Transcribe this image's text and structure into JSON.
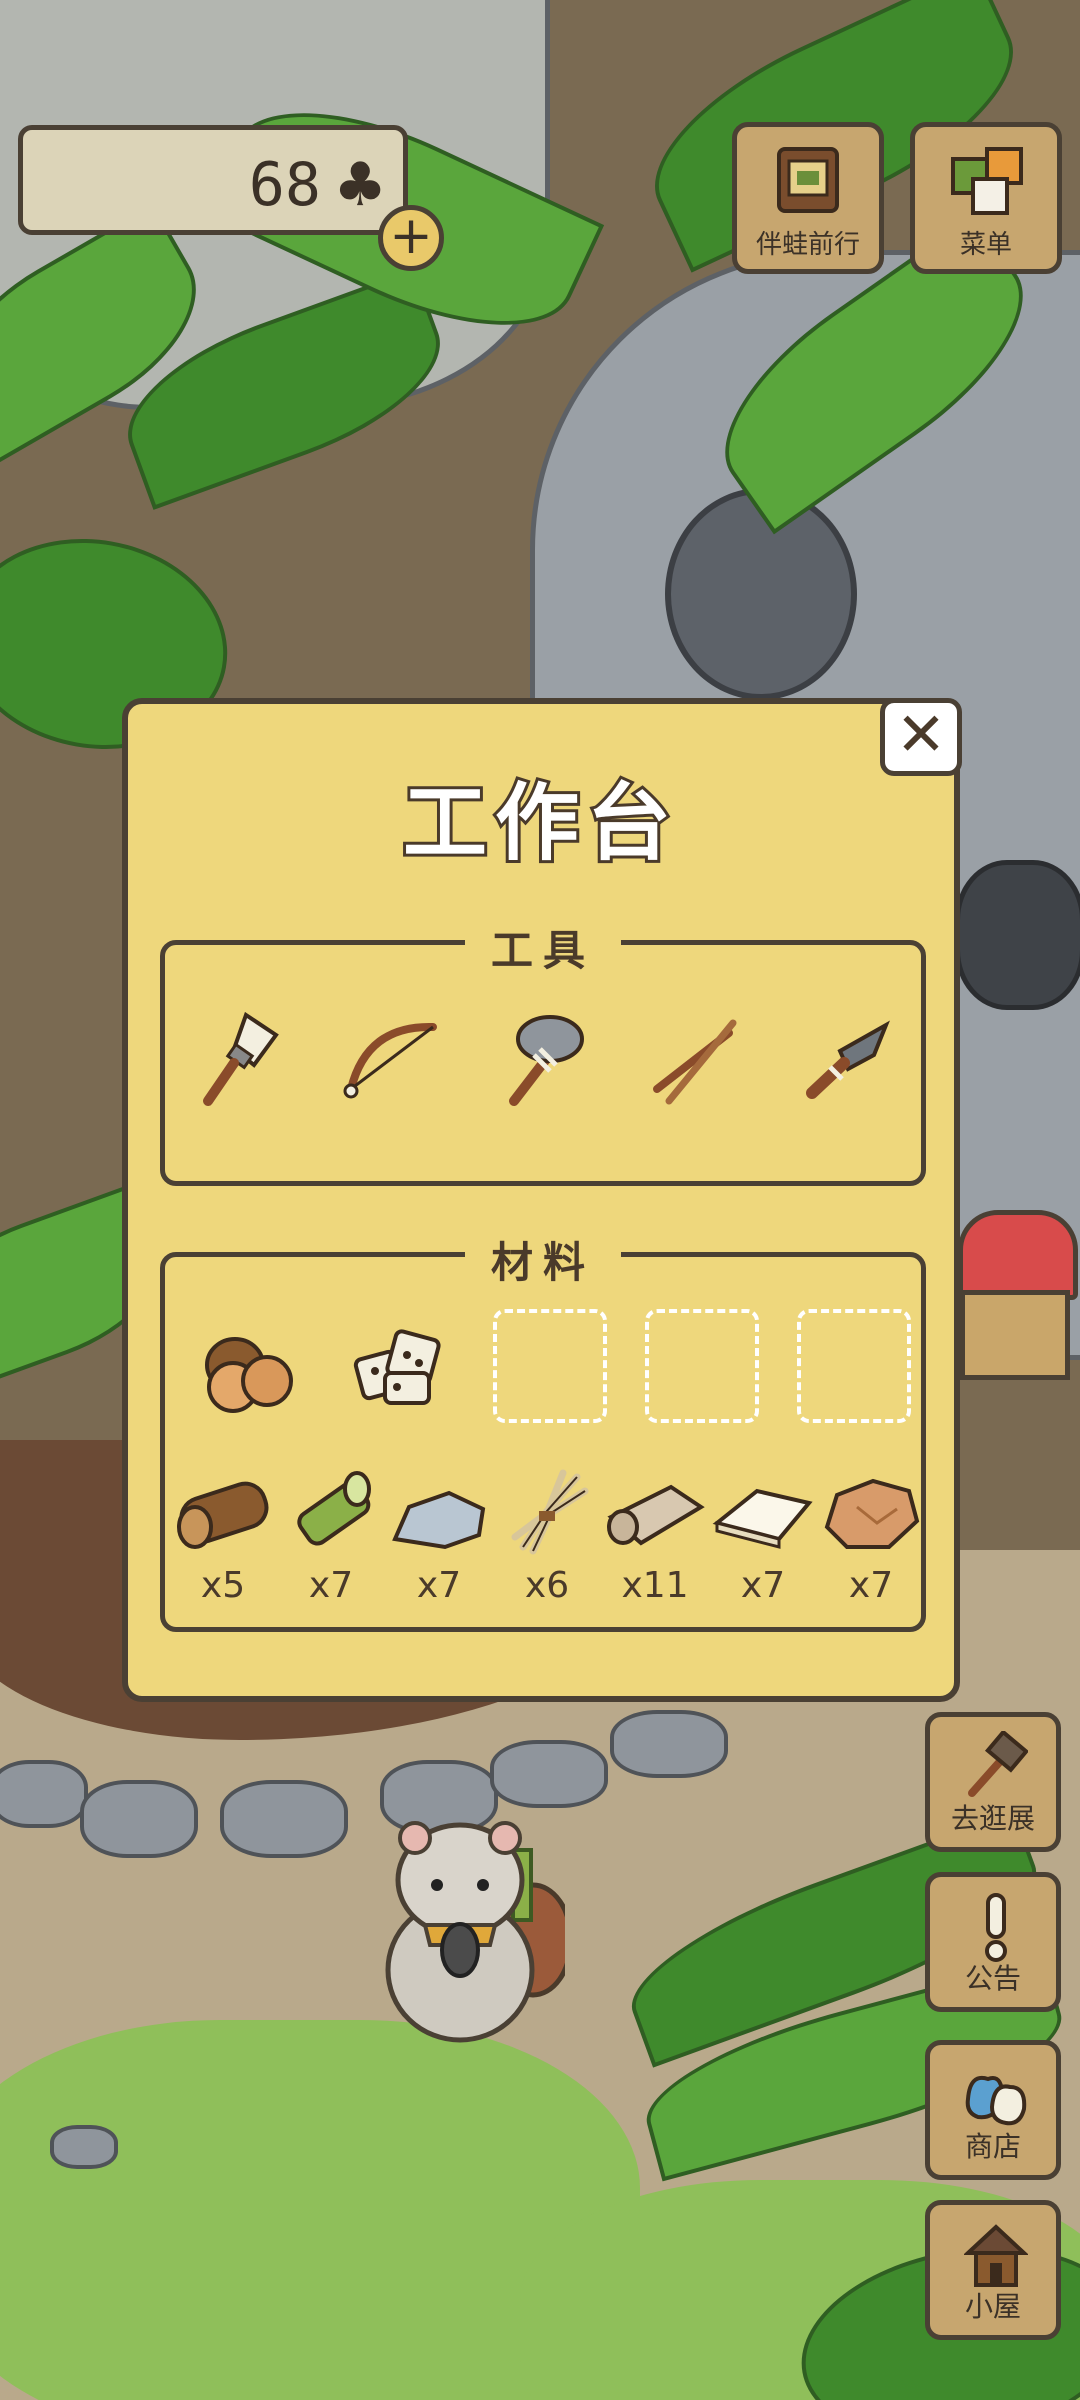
{
  "hud": {
    "clover_count": "68",
    "clover_symbol": "♣",
    "add_symbol": "+"
  },
  "top_buttons": [
    {
      "label": "伴蛙前行",
      "icon": "book-icon"
    },
    {
      "label": "菜单",
      "icon": "menu-cards-icon"
    }
  ],
  "workbench": {
    "title": "工作台",
    "close_symbol": "✕",
    "tools_label": "工具",
    "tools": [
      "brush-icon",
      "bow-icon",
      "stone-axe-icon",
      "sticks-icon",
      "knife-icon"
    ],
    "materials_label": "材料",
    "selected_materials": [
      "chestnuts-icon",
      "dice-icon"
    ],
    "empty_slots": 3,
    "inventory": [
      {
        "icon": "log-icon",
        "count": "x5"
      },
      {
        "icon": "bamboo-icon",
        "count": "x7"
      },
      {
        "icon": "stone-icon",
        "count": "x7"
      },
      {
        "icon": "straw-icon",
        "count": "x6"
      },
      {
        "icon": "cloth-roll-icon",
        "count": "x11"
      },
      {
        "icon": "paper-icon",
        "count": "x7"
      },
      {
        "icon": "leather-icon",
        "count": "x7"
      }
    ]
  },
  "side_buttons": [
    {
      "label": "去逛展",
      "icon": "hammer-icon"
    },
    {
      "label": "公告",
      "icon": "exclamation-icon"
    },
    {
      "label": "商店",
      "icon": "bags-icon"
    },
    {
      "label": "小屋",
      "icon": "house-icon"
    }
  ]
}
